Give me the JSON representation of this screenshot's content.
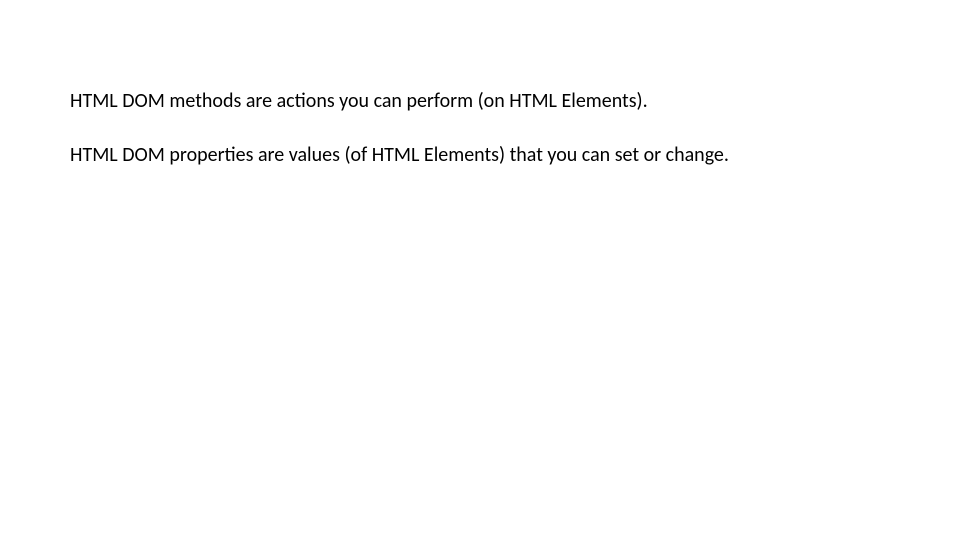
{
  "paragraphs": {
    "p1": "HTML DOM methods are actions you can perform (on HTML Elements).",
    "p2": "HTML DOM properties are values (of HTML Elements) that you can set or change."
  }
}
